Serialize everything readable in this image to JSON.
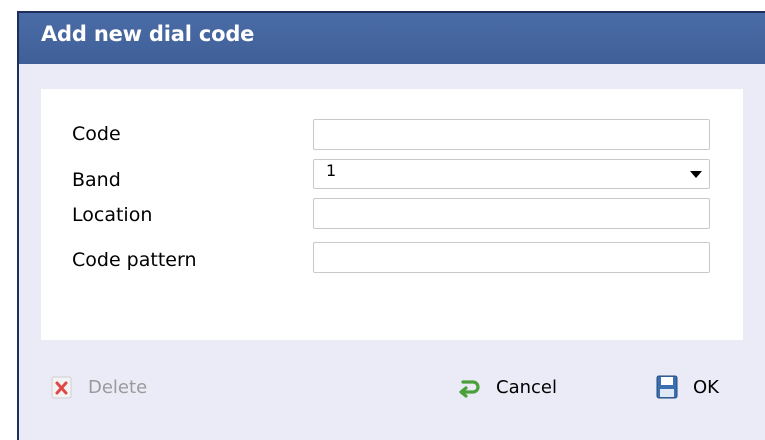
{
  "dialog": {
    "title": "Add new dial code"
  },
  "form": {
    "code": {
      "label": "Code",
      "value": ""
    },
    "band": {
      "label": "Band",
      "value": "1"
    },
    "location": {
      "label": "Location",
      "value": ""
    },
    "code_pattern": {
      "label": "Code pattern",
      "value": ""
    }
  },
  "buttons": {
    "delete": {
      "label": "Delete",
      "icon": "delete-x-icon",
      "disabled": true
    },
    "cancel": {
      "label": "Cancel",
      "icon": "cancel-arrow-icon"
    },
    "ok": {
      "label": "OK",
      "icon": "save-disk-icon"
    }
  },
  "colors": {
    "titlebar": "#4267a0",
    "background": "#ebebf7",
    "panel": "#ffffff",
    "cancel_icon": "#4aa03a",
    "delete_icon": "#d93030"
  }
}
